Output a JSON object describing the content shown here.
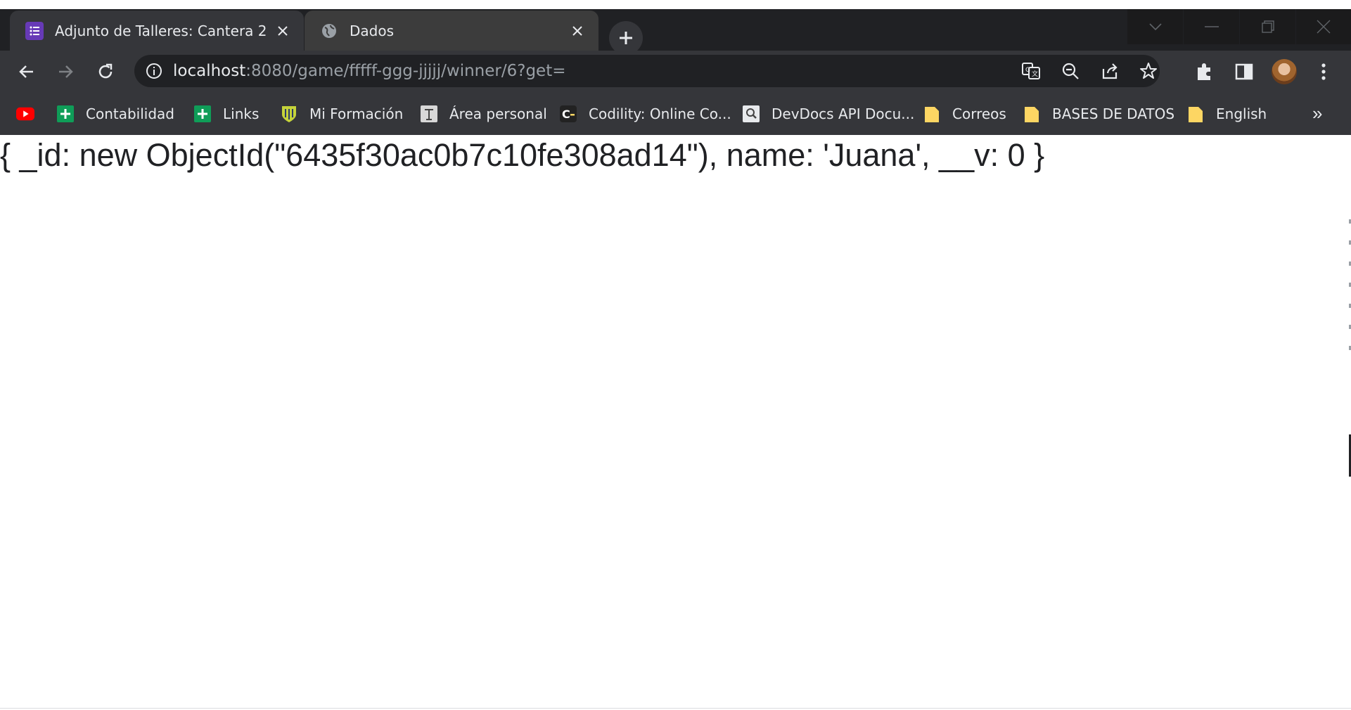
{
  "browser": {
    "tabs": [
      {
        "title": "Adjunto de Talleres: Cantera 2",
        "favicon": "forms-list-icon",
        "active": false
      },
      {
        "title": "Dados",
        "favicon": "globe-icon",
        "active": true
      }
    ],
    "address_bar": {
      "host": "localhost",
      "path": ":8080/game/fffff-ggg-jjjjj/winner/6?get="
    },
    "bookmarks": [
      {
        "label": "",
        "icon": "youtube-icon"
      },
      {
        "label": "Contabilidad",
        "icon": "sheets-icon"
      },
      {
        "label": "Links",
        "icon": "sheets-icon"
      },
      {
        "label": "Mi Formación",
        "icon": "shield-crest-icon"
      },
      {
        "label": "Área personal",
        "icon": "site-icon"
      },
      {
        "label": "Codility: Online Co...",
        "icon": "codility-icon"
      },
      {
        "label": "DevDocs API Docu...",
        "icon": "search-doc-icon"
      },
      {
        "label": "Correos",
        "icon": "folder-icon"
      },
      {
        "label": "BASES DE DATOS",
        "icon": "folder-icon"
      },
      {
        "label": "English",
        "icon": "folder-icon"
      }
    ],
    "bookmarks_overflow": "»"
  },
  "page": {
    "content": "{ _id: new ObjectId(\"6435f30ac0b7c10fe308ad14\"), name: 'Juana', __v: 0 }"
  },
  "colors": {
    "tabstrip_bg": "#202124",
    "toolbar_bg": "#35363a",
    "active_tab_bg": "#3c3c3c",
    "omnibox_bg": "#202124",
    "text_light": "#e8eaed",
    "url_path": "#9aa0a6",
    "forms_purple": "#673ab7",
    "sheets_green": "#0f9d58",
    "youtube_red": "#ff0000",
    "folder_yellow": "#fdd663"
  }
}
